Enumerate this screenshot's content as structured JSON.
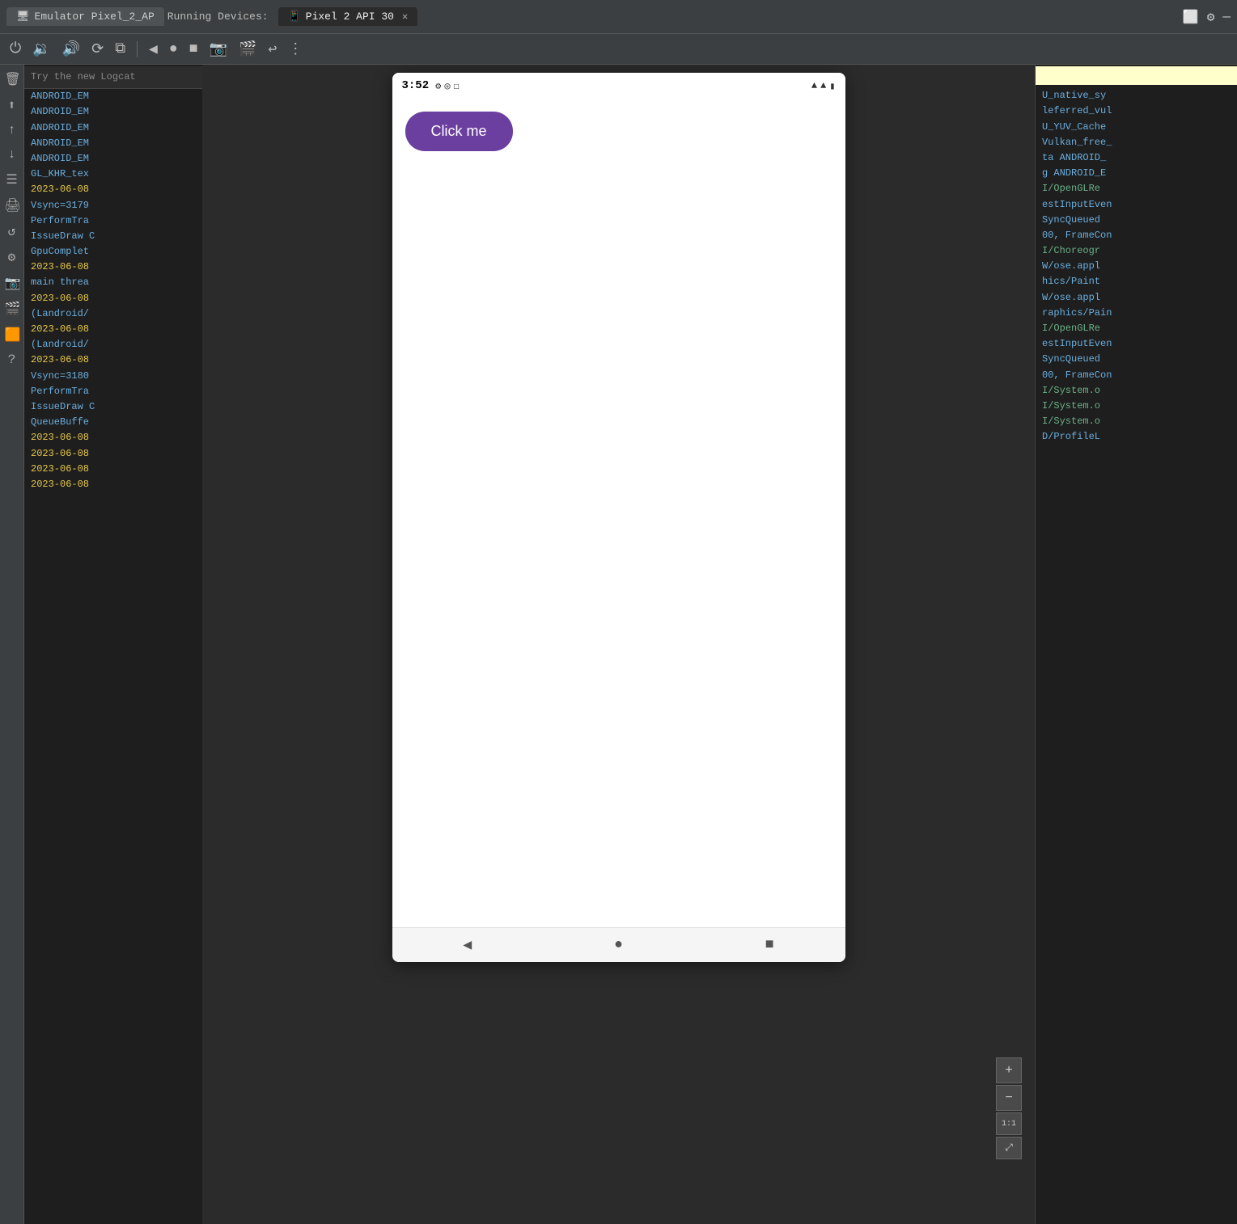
{
  "topbar": {
    "tab1_label": "Emulator Pixel_2_AP",
    "tab2_label": "Pixel 2 API 30",
    "running_label": "Running Devices:",
    "icon_monitor": "⬜",
    "icon_gear": "⚙",
    "icon_dash": "—"
  },
  "toolbar": {
    "icon_power": "⏻",
    "icon_vol_down": "🔈",
    "icon_vol_up": "🔊",
    "icon_rotate": "⟳",
    "icon_fold": "⧉",
    "icon_back": "◀",
    "icon_record": "●",
    "icon_stop": "■",
    "icon_camera": "📷",
    "icon_video": "🎬",
    "icon_replay": "↩",
    "icon_more": "⋮"
  },
  "sidebar": {
    "icons": [
      "🗑",
      "⬆",
      "↑",
      "↓",
      "≡",
      "🖨",
      "↺",
      "⚙",
      "📷",
      "🎬",
      "🟧",
      "?"
    ]
  },
  "emulator": {
    "status_time": "3:52",
    "status_icon1": "⚙",
    "status_icon2": "◎",
    "status_icon3": "☐",
    "wifi_icon": "▲",
    "signal_icon": "▲",
    "battery_icon": "▮",
    "button_label": "Click me",
    "nav_back": "◀",
    "nav_home": "●",
    "nav_recent": "■",
    "zoom_plus": "+",
    "zoom_minus": "−",
    "zoom_pct": "1:1",
    "zoom_expand": "⤢"
  },
  "logcat_left": {
    "search_placeholder": "Try the new Logcat",
    "entries": [
      {
        "type": "cyan",
        "text": "ANDROID_EM"
      },
      {
        "type": "cyan",
        "text": "ANDROID_EM"
      },
      {
        "type": "cyan",
        "text": "ANDROID_EM"
      },
      {
        "type": "cyan",
        "text": "ANDROID_EM"
      },
      {
        "type": "cyan",
        "text": "ANDROID_EM"
      },
      {
        "type": "cyan",
        "text": "GL_KHR_tex"
      },
      {
        "type": "date",
        "text": "2023-06-08"
      },
      {
        "type": "cyan",
        "text": "Vsync=3179"
      },
      {
        "type": "cyan",
        "text": "PerformTra"
      },
      {
        "type": "cyan",
        "text": "IssueDraw C"
      },
      {
        "type": "cyan",
        "text": "GpuComplet"
      },
      {
        "type": "date",
        "text": "2023-06-08"
      },
      {
        "type": "cyan",
        "text": "main threa"
      },
      {
        "type": "date",
        "text": "2023-06-08"
      },
      {
        "type": "cyan",
        "text": "(Landroid/"
      },
      {
        "type": "date",
        "text": "2023-06-08"
      },
      {
        "type": "cyan",
        "text": "(Landroid/"
      },
      {
        "type": "date",
        "text": "2023-06-08"
      },
      {
        "type": "cyan",
        "text": "Vsync=3180"
      },
      {
        "type": "cyan",
        "text": "PerformTra"
      },
      {
        "type": "cyan",
        "text": "IssueDraw C"
      },
      {
        "type": "cyan",
        "text": "QueueBuffe"
      },
      {
        "type": "date",
        "text": "2023-06-08"
      },
      {
        "type": "date",
        "text": "2023-06-08"
      },
      {
        "type": "date",
        "text": "2023-06-08"
      },
      {
        "type": "date",
        "text": "2023-06-08"
      }
    ]
  },
  "logcat_right": {
    "entries": [
      {
        "type": "cyan",
        "text": "U_native_sy"
      },
      {
        "type": "cyan",
        "text": "leferred_vul"
      },
      {
        "type": "cyan",
        "text": "U_YUV_Cache"
      },
      {
        "type": "cyan",
        "text": "Vulkan_free_"
      },
      {
        "type": "cyan",
        "text": "ta ANDROID_"
      },
      {
        "type": "cyan",
        "text": "g ANDROID_E"
      },
      {
        "type": "green",
        "text": "I/OpenGLRe"
      },
      {
        "type": "cyan",
        "text": "estInputEven"
      },
      {
        "type": "cyan",
        "text": "SyncQueued"
      },
      {
        "type": "cyan",
        "text": "00, FrameCon"
      },
      {
        "type": "green",
        "text": "I/Choreogr"
      },
      {
        "type": "cyan",
        "text": "W/ose.appl"
      },
      {
        "type": "cyan",
        "text": "hics/Paint"
      },
      {
        "type": "cyan",
        "text": "W/ose.appl"
      },
      {
        "type": "cyan",
        "text": "raphics/Pain"
      },
      {
        "type": "green",
        "text": "I/OpenGLRe"
      },
      {
        "type": "cyan",
        "text": "estInputEven"
      },
      {
        "type": "cyan",
        "text": "SyncQueued"
      },
      {
        "type": "cyan",
        "text": "00, FrameCon"
      },
      {
        "type": "green",
        "text": "I/System.o"
      },
      {
        "type": "green",
        "text": "I/System.o"
      },
      {
        "type": "green",
        "text": "I/System.o"
      },
      {
        "type": "cyan",
        "text": "D/ProfileL"
      }
    ]
  }
}
